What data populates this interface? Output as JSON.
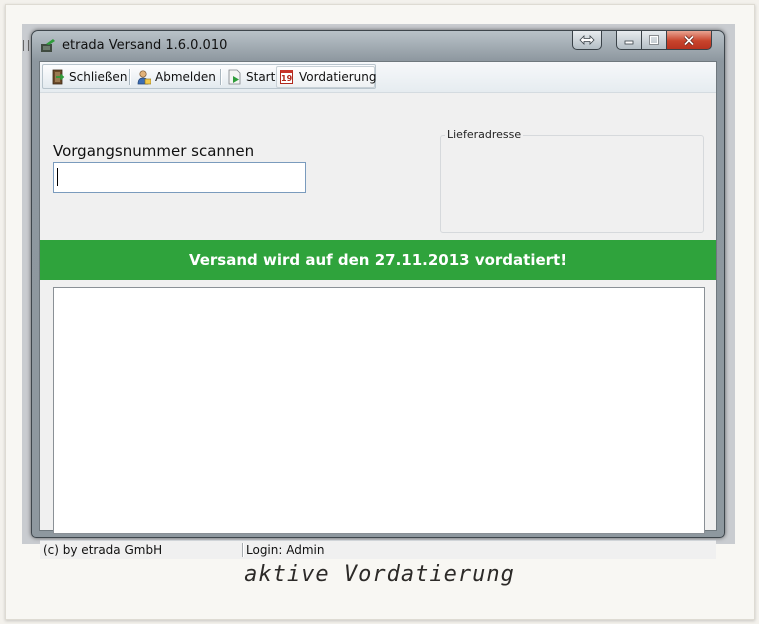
{
  "window": {
    "title": "etrada Versand 1.6.0.010"
  },
  "toolbar": {
    "close_label": "Schließen",
    "logout_label": "Abmelden",
    "start_label": "Start",
    "backdate_label": "Vordatierung",
    "backdate_icon_text": "19"
  },
  "form": {
    "scan_label": "Vorgangsnummer scannen",
    "scan_value": ""
  },
  "delivery": {
    "group_title": "Lieferadresse"
  },
  "banner": {
    "text": "Versand wird auf den 27.11.2013 vordatiert!",
    "color": "#2fa33c"
  },
  "statusbar": {
    "copyright": "(c) by etrada GmbH",
    "login": "Login: Admin"
  },
  "caption": {
    "text": "aktive Vordatierung"
  },
  "icons": [
    "app-icon",
    "resize-icon",
    "minimize-icon",
    "maximize-icon",
    "close-icon",
    "door-exit-icon",
    "user-logout-icon",
    "document-play-icon",
    "calendar-icon"
  ]
}
